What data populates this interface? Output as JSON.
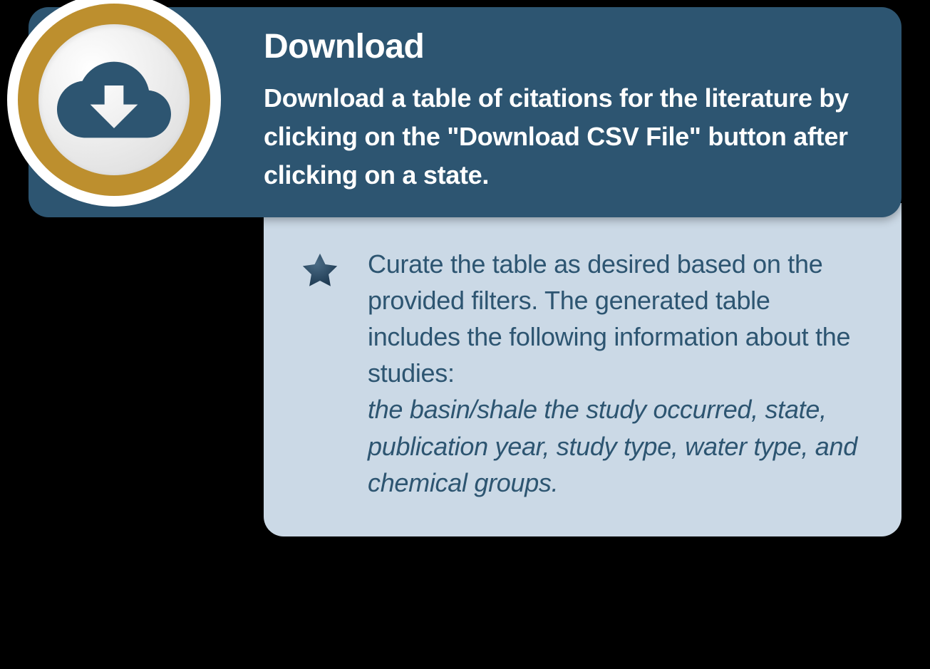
{
  "header": {
    "title": "Download",
    "description": "Download a table of citations for the literature by clicking on the \"Download CSV File\" button after clicking on a state."
  },
  "body": {
    "text_main": "Curate the table as desired based on the provided filters. The generated table includes the following information about the studies:",
    "text_italic": "the basin/shale the study occurred, state, publication year, study type, water type, and chemical groups."
  },
  "colors": {
    "header_bg": "#2d5571",
    "body_bg": "#cbd9e6",
    "ring": "#bd8f2e",
    "text_dark": "#2d5571",
    "text_light": "#ffffff"
  }
}
